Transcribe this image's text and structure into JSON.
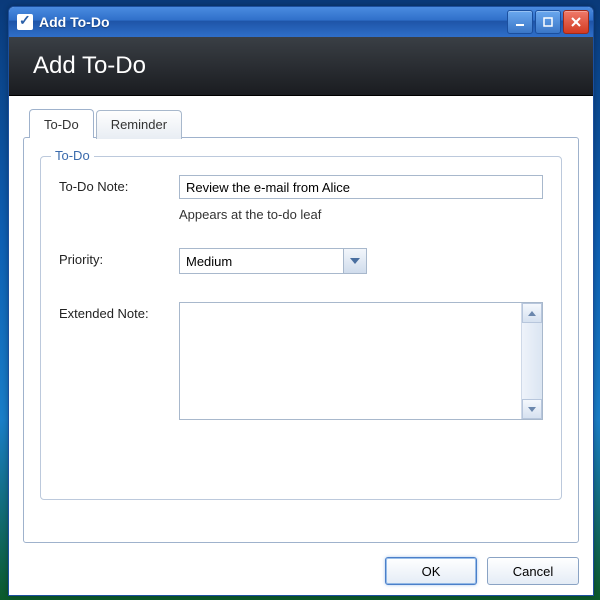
{
  "window": {
    "title": "Add To-Do"
  },
  "header": {
    "heading": "Add To-Do"
  },
  "tabs": [
    {
      "label": "To-Do",
      "active": true
    },
    {
      "label": "Reminder",
      "active": false
    }
  ],
  "group": {
    "title": "To-Do",
    "note_label": "To-Do Note:",
    "note_value": "Review the e-mail from Alice",
    "note_helper": "Appears at the to-do leaf",
    "priority_label": "Priority:",
    "priority_value": "Medium",
    "extended_label": "Extended Note:",
    "extended_value": ""
  },
  "buttons": {
    "ok": "OK",
    "cancel": "Cancel"
  }
}
